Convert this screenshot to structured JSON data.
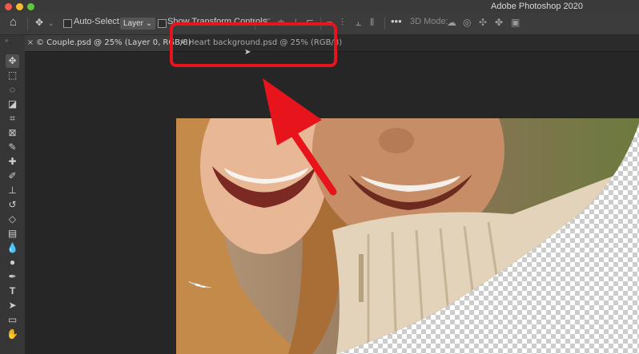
{
  "app": {
    "title": "Adobe Photoshop 2020"
  },
  "options_bar": {
    "auto_select_label": "Auto-Select:",
    "auto_select_target": "Layer",
    "show_transform_label": "Show Transform Controls",
    "more_label": "•••",
    "mode_3d_label": "3D Mode:"
  },
  "tabs": [
    {
      "label": "© Couple.psd @ 25% (Layer 0, RGB/8)",
      "close": "×",
      "active": true
    },
    {
      "label": "Heart background.psd @ 25% (RGB/8)",
      "close": "×",
      "active": false
    }
  ],
  "tools": [
    "move-icon",
    "marquee-icon",
    "lasso-icon",
    "quick-select-icon",
    "crop-icon",
    "frame-icon",
    "eyedropper-icon",
    "healing-brush-icon",
    "brush-icon",
    "clone-stamp-icon",
    "history-brush-icon",
    "eraser-icon",
    "gradient-icon",
    "blur-icon",
    "dodge-icon",
    "pen-icon",
    "type-icon",
    "path-select-icon",
    "shape-icon",
    "hand-icon"
  ],
  "colors": {
    "highlight": "#e8141c",
    "background": "#262626"
  }
}
